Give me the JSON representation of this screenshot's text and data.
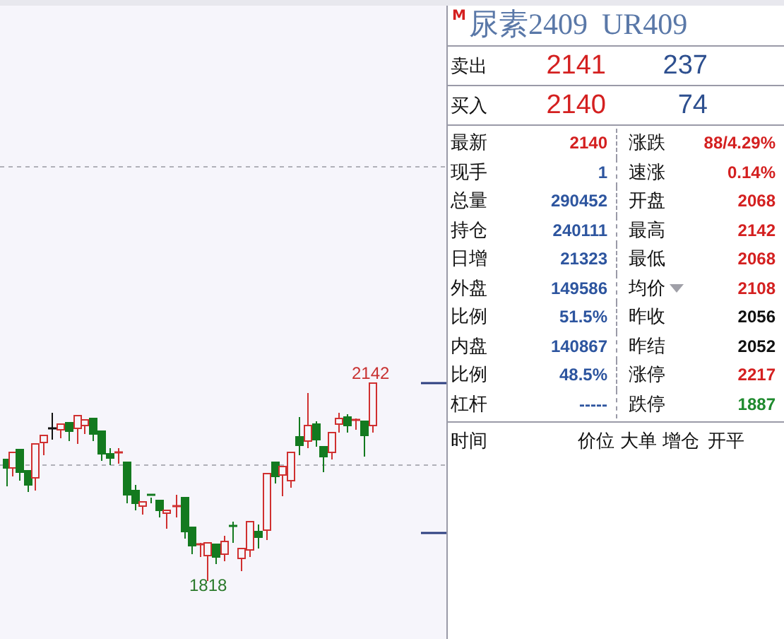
{
  "chart": {
    "high_label": "2142",
    "low_label": "1818"
  },
  "quote_panel": {
    "badge": "M",
    "name": "尿素2409",
    "code": "UR409",
    "book": [
      {
        "label": "卖出",
        "price": "2141",
        "volume": "237"
      },
      {
        "label": "买入",
        "price": "2140",
        "volume": "74"
      }
    ],
    "stats": [
      {
        "left": {
          "label": "最新",
          "value": "2140",
          "color": "#d42020"
        },
        "right": {
          "label": "涨跌",
          "value": "88/4.29%",
          "color": "#d42020",
          "dropdown": false
        }
      },
      {
        "left": {
          "label": "现手",
          "value": "1",
          "color": "#2d559f"
        },
        "right": {
          "label": "速涨",
          "value": "0.14%",
          "color": "#d42020",
          "dropdown": false
        }
      },
      {
        "left": {
          "label": "总量",
          "value": "290452",
          "color": "#2d559f"
        },
        "right": {
          "label": "开盘",
          "value": "2068",
          "color": "#d42020",
          "dropdown": false
        }
      },
      {
        "left": {
          "label": "持仓",
          "value": "240111",
          "color": "#2d559f"
        },
        "right": {
          "label": "最高",
          "value": "2142",
          "color": "#d42020",
          "dropdown": false
        }
      },
      {
        "left": {
          "label": "日增",
          "value": "21323",
          "color": "#2d559f"
        },
        "right": {
          "label": "最低",
          "value": "2068",
          "color": "#d42020",
          "dropdown": false
        }
      },
      {
        "left": {
          "label": "外盘",
          "value": "149586",
          "color": "#2d559f"
        },
        "right": {
          "label": "均价",
          "value": "2108",
          "color": "#d42020",
          "dropdown": true
        }
      },
      {
        "left": {
          "label": "比例",
          "value": "51.5%",
          "color": "#2d559f"
        },
        "right": {
          "label": "昨收",
          "value": "2056",
          "color": "#111111",
          "dropdown": false
        }
      },
      {
        "left": {
          "label": "内盘",
          "value": "140867",
          "color": "#2d559f"
        },
        "right": {
          "label": "昨结",
          "value": "2052",
          "color": "#111111",
          "dropdown": false
        }
      },
      {
        "left": {
          "label": "比例",
          "value": "48.5%",
          "color": "#2d559f"
        },
        "right": {
          "label": "涨停",
          "value": "2217",
          "color": "#d42020",
          "dropdown": false
        }
      },
      {
        "left": {
          "label": "杠杆",
          "value": "-----",
          "color": "#2d559f"
        },
        "right": {
          "label": "跌停",
          "value": "1887",
          "color": "#1f8a2e",
          "dropdown": false
        }
      }
    ],
    "columns": [
      "时间",
      "价位",
      "大单",
      "增仓",
      "开平"
    ]
  }
}
